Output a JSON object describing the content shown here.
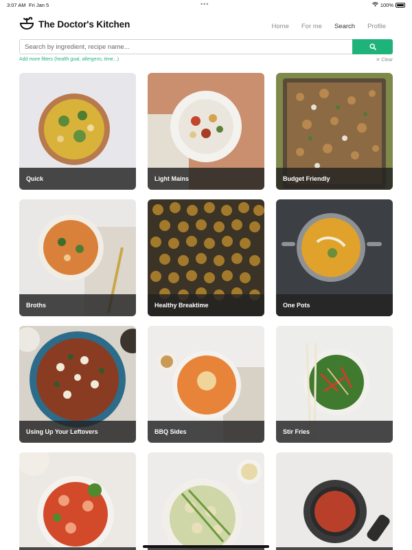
{
  "status_bar": {
    "time": "3:07 AM",
    "date": "Fri Jan 5",
    "dots": "•••",
    "battery": "100%"
  },
  "header": {
    "brand": "The Doctor's Kitchen",
    "nav": [
      {
        "label": "Home",
        "active": false
      },
      {
        "label": "For me",
        "active": false
      },
      {
        "label": "Search",
        "active": true
      },
      {
        "label": "Profile",
        "active": false
      }
    ]
  },
  "search": {
    "placeholder": "Search by ingredient, recipe name...",
    "filters_link": "Add more filters (health goal, allergens, time...)",
    "clear_label": "✕ Clear"
  },
  "colors": {
    "accent": "#1fb37c",
    "label_overlay": "#222222"
  },
  "categories": [
    {
      "label": "Quick"
    },
    {
      "label": "Light Mains"
    },
    {
      "label": "Budget Friendly"
    },
    {
      "label": "Broths"
    },
    {
      "label": "Healthy Breaktime"
    },
    {
      "label": "One Pots"
    },
    {
      "label": "Using Up Your Leftovers"
    },
    {
      "label": "BBQ Sides"
    },
    {
      "label": "Stir Fries"
    },
    {
      "label": ""
    },
    {
      "label": ""
    },
    {
      "label": ""
    }
  ]
}
